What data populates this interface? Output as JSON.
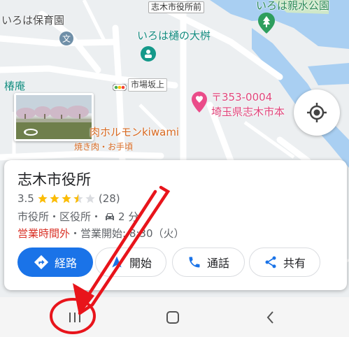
{
  "map": {
    "labels": {
      "nursery": "いろは保育園",
      "city_hall_front": "志木市役所前",
      "shinsui_park": "いろは親水公園",
      "keyaki": "いろは樋の大桝",
      "tsubakian": "椿庵",
      "ichiba_sakaue": "市場坂上",
      "postal": "〒353-0004",
      "address": "埼玉県志木市本",
      "restaurant": "肉ホルモンkiwami",
      "restaurant_sub": "焼き肉・お手頃"
    },
    "colors": {
      "water": "#a9cff2",
      "road": "#ffffff",
      "park": "#cfe8c8",
      "land": "#eceff1"
    }
  },
  "card": {
    "title": "志木市役所",
    "rating_value": "3.5",
    "stars": 3.5,
    "review_count": "(28)",
    "category": "市役所・区役所・",
    "drive_time": "2 分",
    "status_closed": "営業時間外",
    "opening": "・営業開始: 8:30（火）",
    "buttons": {
      "directions": "経路",
      "start": "開始",
      "call": "通話",
      "share": "共有"
    },
    "colors": {
      "primary": "#1a73e8",
      "closed": "#d93025",
      "star": "#fbbc04"
    }
  },
  "annotation": {
    "color": "#e8141b"
  }
}
